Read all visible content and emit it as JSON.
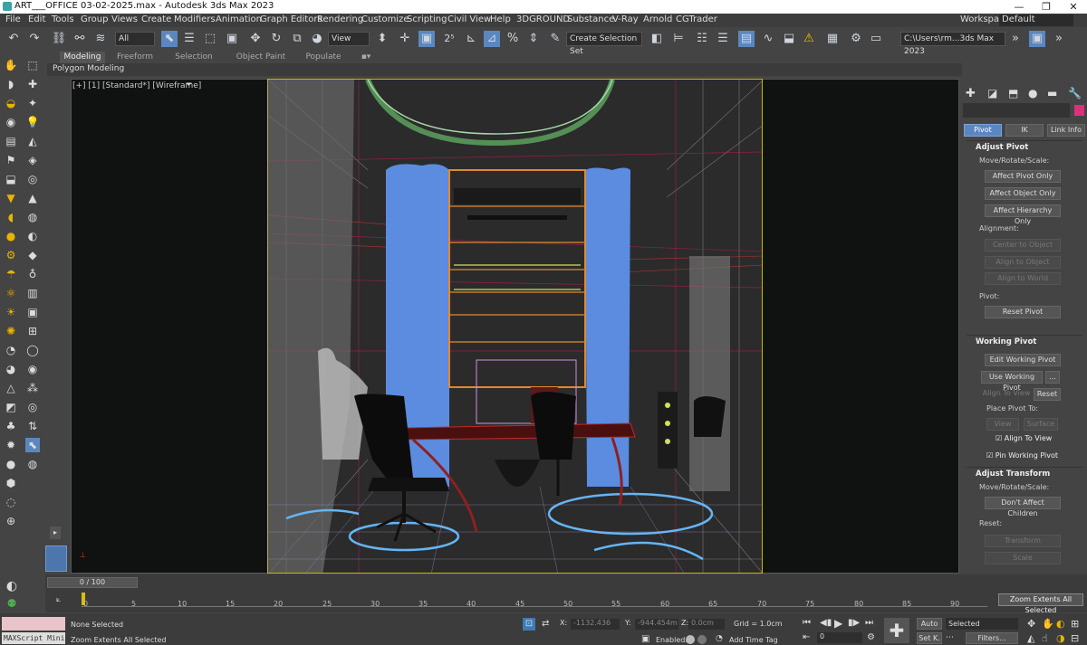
{
  "window": {
    "title": "ART___OFFICE 03-02-2025.max - Autodesk 3ds Max 2023",
    "min": "—",
    "max": "❐",
    "close": "✕"
  },
  "menu": [
    "File",
    "Edit",
    "Tools",
    "Group",
    "Views",
    "Create",
    "Modifiers",
    "Animation",
    "Graph Editors",
    "Rendering",
    "Customize",
    "Scripting",
    "Civil View",
    "Help",
    "3DGROUND",
    "Substance",
    "V-Ray",
    "Arnold",
    "CGTrader"
  ],
  "workspaces": {
    "label": "Workspaces:",
    "value": "Default"
  },
  "toolbar": {
    "selection_filter": "All",
    "ref_coord": "View",
    "selection_set": "Create Selection Set",
    "project_path": "C:\\Users\\rm...3ds Max 2023"
  },
  "ribbon_tabs": [
    "Modeling",
    "Freeform",
    "Selection",
    "Object Paint",
    "Populate"
  ],
  "polygon_modeling": "Polygon Modeling",
  "viewport": {
    "label": "[+] [1] [Standard*] [Wireframe]"
  },
  "cmd_panel": {
    "tabs": [
      "Pivot",
      "IK",
      "Link Info"
    ],
    "adjust_pivot": {
      "title": "Adjust Pivot",
      "move_label": "Move/Rotate/Scale:",
      "buttons": [
        "Affect Pivot Only",
        "Affect Object Only",
        "Affect Hierarchy Only"
      ],
      "alignment_label": "Alignment:",
      "align_buttons": [
        "Center to Object",
        "Align to Object",
        "Align to World"
      ],
      "pivot_label": "Pivot:",
      "reset": "Reset Pivot"
    },
    "working_pivot": {
      "title": "Working Pivot",
      "edit": "Edit Working Pivot",
      "use": "Use Working Pivot",
      "dots": "...",
      "align_view": "Align To View",
      "reset": "Reset",
      "place_label": "Place Pivot To:",
      "view": "View",
      "surface": "Surface",
      "align_to_view": "Align To View",
      "pin": "Pin Working Pivot"
    },
    "adjust_transform": {
      "title": "Adjust Transform",
      "move_label": "Move/Rotate/Scale:",
      "dont_affect": "Don't Affect Children",
      "reset_label": "Reset:",
      "transform": "Transform",
      "scale": "Scale"
    }
  },
  "timeline": {
    "slider": "0 / 100",
    "ticks": [
      "0",
      "5",
      "10",
      "15",
      "20",
      "25",
      "30",
      "35",
      "40",
      "45",
      "50",
      "55",
      "60",
      "65",
      "70",
      "75",
      "80",
      "85",
      "90"
    ]
  },
  "status": {
    "maxscript": "MAXScript Mini",
    "selected": "None Selected",
    "prompt": "Zoom Extents All Selected",
    "x_label": "X:",
    "x": "-1132.436",
    "y_label": "Y:",
    "y": "-944.454m",
    "z_label": "Z:",
    "z": "0.0cm",
    "grid": "Grid = 1.0cm",
    "enabled": "Enabled:",
    "add_time_tag": "Add Time Tag",
    "auto": "Auto",
    "set_key": "Set K.",
    "key_filter": "Selected",
    "filters": "Filters...",
    "frame": "0",
    "tooltip": "Zoom Extents All Selected"
  },
  "icons": [
    "undo-icon",
    "redo-icon",
    "link-icon",
    "unlink-icon",
    "select-icon",
    "move-icon",
    "rotate-icon",
    "scale-icon",
    "snap-icon",
    "play-icon",
    "zoom-extents-icon"
  ]
}
